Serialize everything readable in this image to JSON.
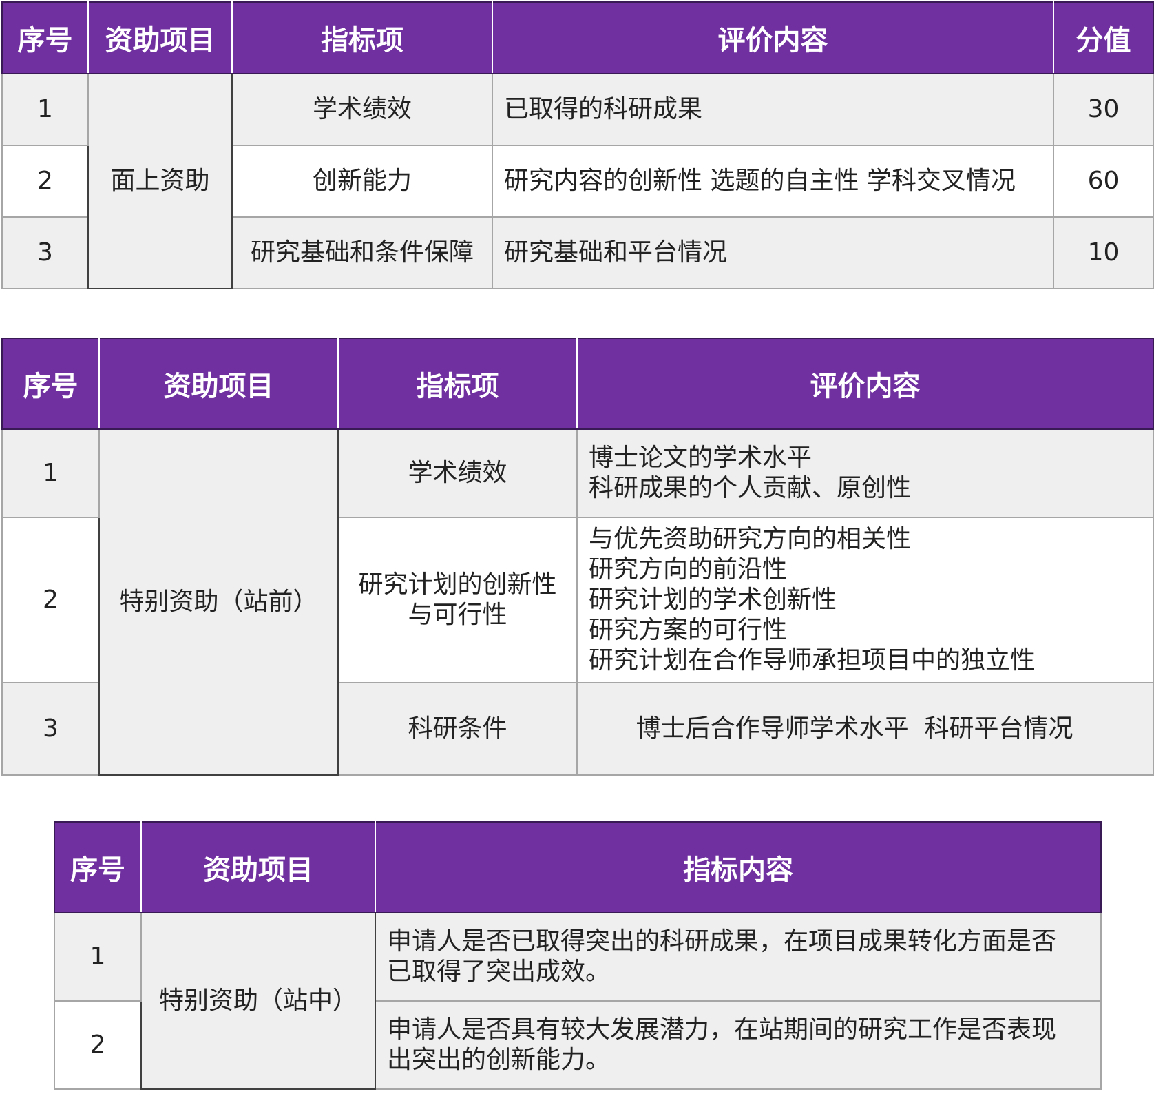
{
  "table1": {
    "headers": [
      "序号",
      "资助项目",
      "指标项",
      "评价内容",
      "分值"
    ],
    "project": "面上资助",
    "rows": [
      {
        "no": "1",
        "indicator": "学术绩效",
        "content": "已取得的科研成果",
        "score": "30"
      },
      {
        "no": "2",
        "indicator": "创新能力",
        "content": "研究内容的创新性 选题的自主性 学科交叉情况",
        "score": "60"
      },
      {
        "no": "3",
        "indicator": "研究基础和条件保障",
        "content": "研究基础和平台情况",
        "score": "10"
      }
    ]
  },
  "table2": {
    "headers": [
      "序号",
      "资助项目",
      "指标项",
      "评价内容"
    ],
    "project": "特别资助（站前）",
    "rows": [
      {
        "no": "1",
        "indicator": [
          "学术绩效"
        ],
        "content": [
          "博士论文的学术水平",
          "科研成果的个人贡献、原创性"
        ]
      },
      {
        "no": "2",
        "indicator": [
          "研究计划的创新性",
          "与可行性"
        ],
        "content": [
          "与优先资助研究方向的相关性",
          "研究方向的前沿性",
          "研究计划的学术创新性",
          "研究方案的可行性",
          "研究计划在合作导师承担项目中的独立性"
        ]
      },
      {
        "no": "3",
        "indicator": [
          "科研条件"
        ],
        "content": [
          "博士后合作导师学术水平  科研平台情况"
        ]
      }
    ]
  },
  "table3": {
    "headers": [
      "序号",
      "资助项目",
      "指标内容"
    ],
    "project": "特别资助（站中）",
    "rows": [
      {
        "no": "1",
        "content": [
          "申请人是否已取得突出的科研成果，在项目成果转化方面是否",
          "已取得了突出成效。"
        ]
      },
      {
        "no": "2",
        "content": [
          "申请人是否具有较大发展潜力，在站期间的研究工作是否表现",
          "出突出的创新能力。"
        ]
      }
    ]
  }
}
